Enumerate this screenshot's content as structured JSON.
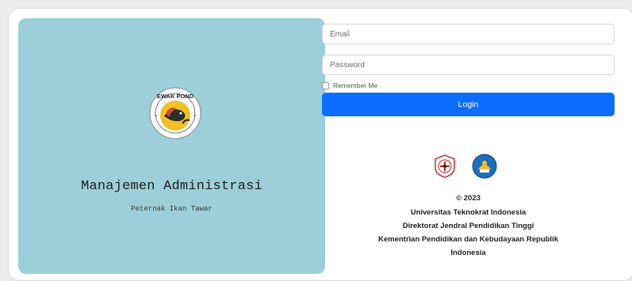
{
  "branding": {
    "app_title": "Manajemen Administrasi",
    "app_subtitle": "Peternak Ikan Tawar",
    "logo_text": "EWAK POND"
  },
  "form": {
    "email_placeholder": "Email",
    "password_placeholder": "Password",
    "remember_label": "Remember Me",
    "login_label": "Login"
  },
  "footer": {
    "year": "© 2023",
    "university": "Universitas Teknokrat Indonesia",
    "directorate": "Direktorat Jendral Pendidikan Tinggi",
    "ministry": "Kementrian Pendidikan dan Kebudayaan Republik",
    "country": "Indonesia"
  },
  "colors": {
    "left_panel_bg": "#9ccfd9",
    "login_button": "#0d6efd"
  },
  "icons": {
    "logo": "ewak-pond-logo-icon",
    "emblem_left": "university-emblem-icon",
    "emblem_right": "ministry-emblem-icon"
  }
}
